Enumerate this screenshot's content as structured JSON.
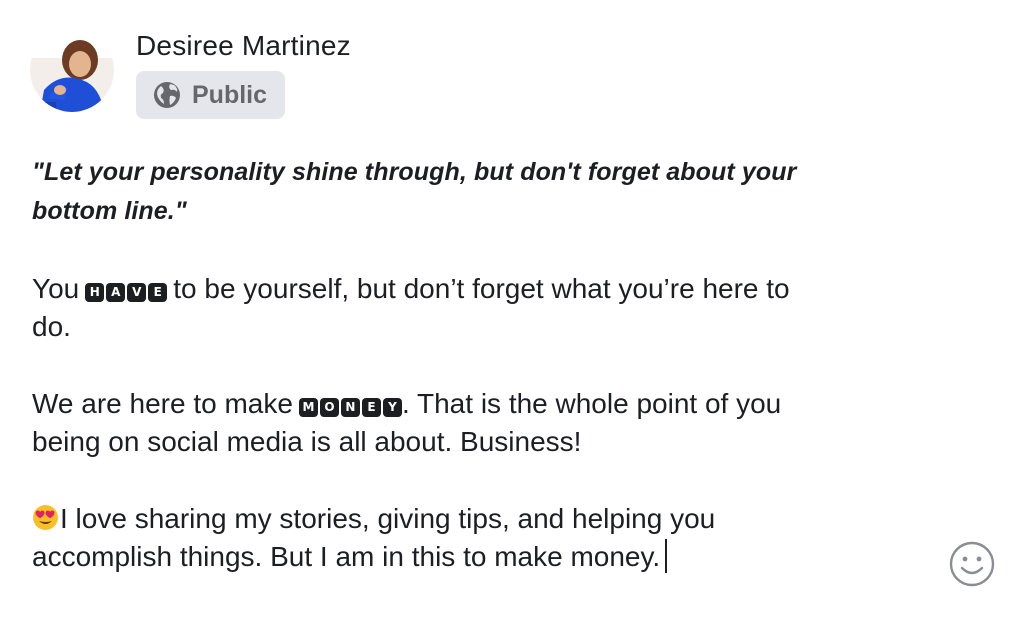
{
  "post": {
    "author": {
      "name": "Desiree Martinez"
    },
    "privacy": {
      "label": "Public",
      "icon": "globe-icon"
    },
    "quote_line_1": "\"Let your personality shine through, but don't forget about your",
    "quote_line_2": "bottom line.\"",
    "para1": {
      "before": "You",
      "squared_word": [
        "H",
        "A",
        "V",
        "E"
      ],
      "after_line1": "to be yourself, but don’t forget what you’re here to",
      "line2": "do."
    },
    "para2": {
      "before": "We are here to make",
      "squared_word": [
        "M",
        "O",
        "N",
        "E",
        "Y"
      ],
      "after_line1": ". That is the whole point of you",
      "line2": "being on social media is all about. Business!"
    },
    "para3": {
      "emoji": "smiling-face-with-heart-eyes",
      "line1": "I love sharing my stories, giving tips, and helping you",
      "line2": "accomplish things. But I am in this to make money."
    }
  },
  "toolbar": {
    "emoji_button_icon": "smiley-icon"
  },
  "colors": {
    "text": "#1c1e21",
    "secondary_text": "#65676b",
    "privacy_bg": "#e4e6eb",
    "emoji_icon": "#8a8d91"
  }
}
